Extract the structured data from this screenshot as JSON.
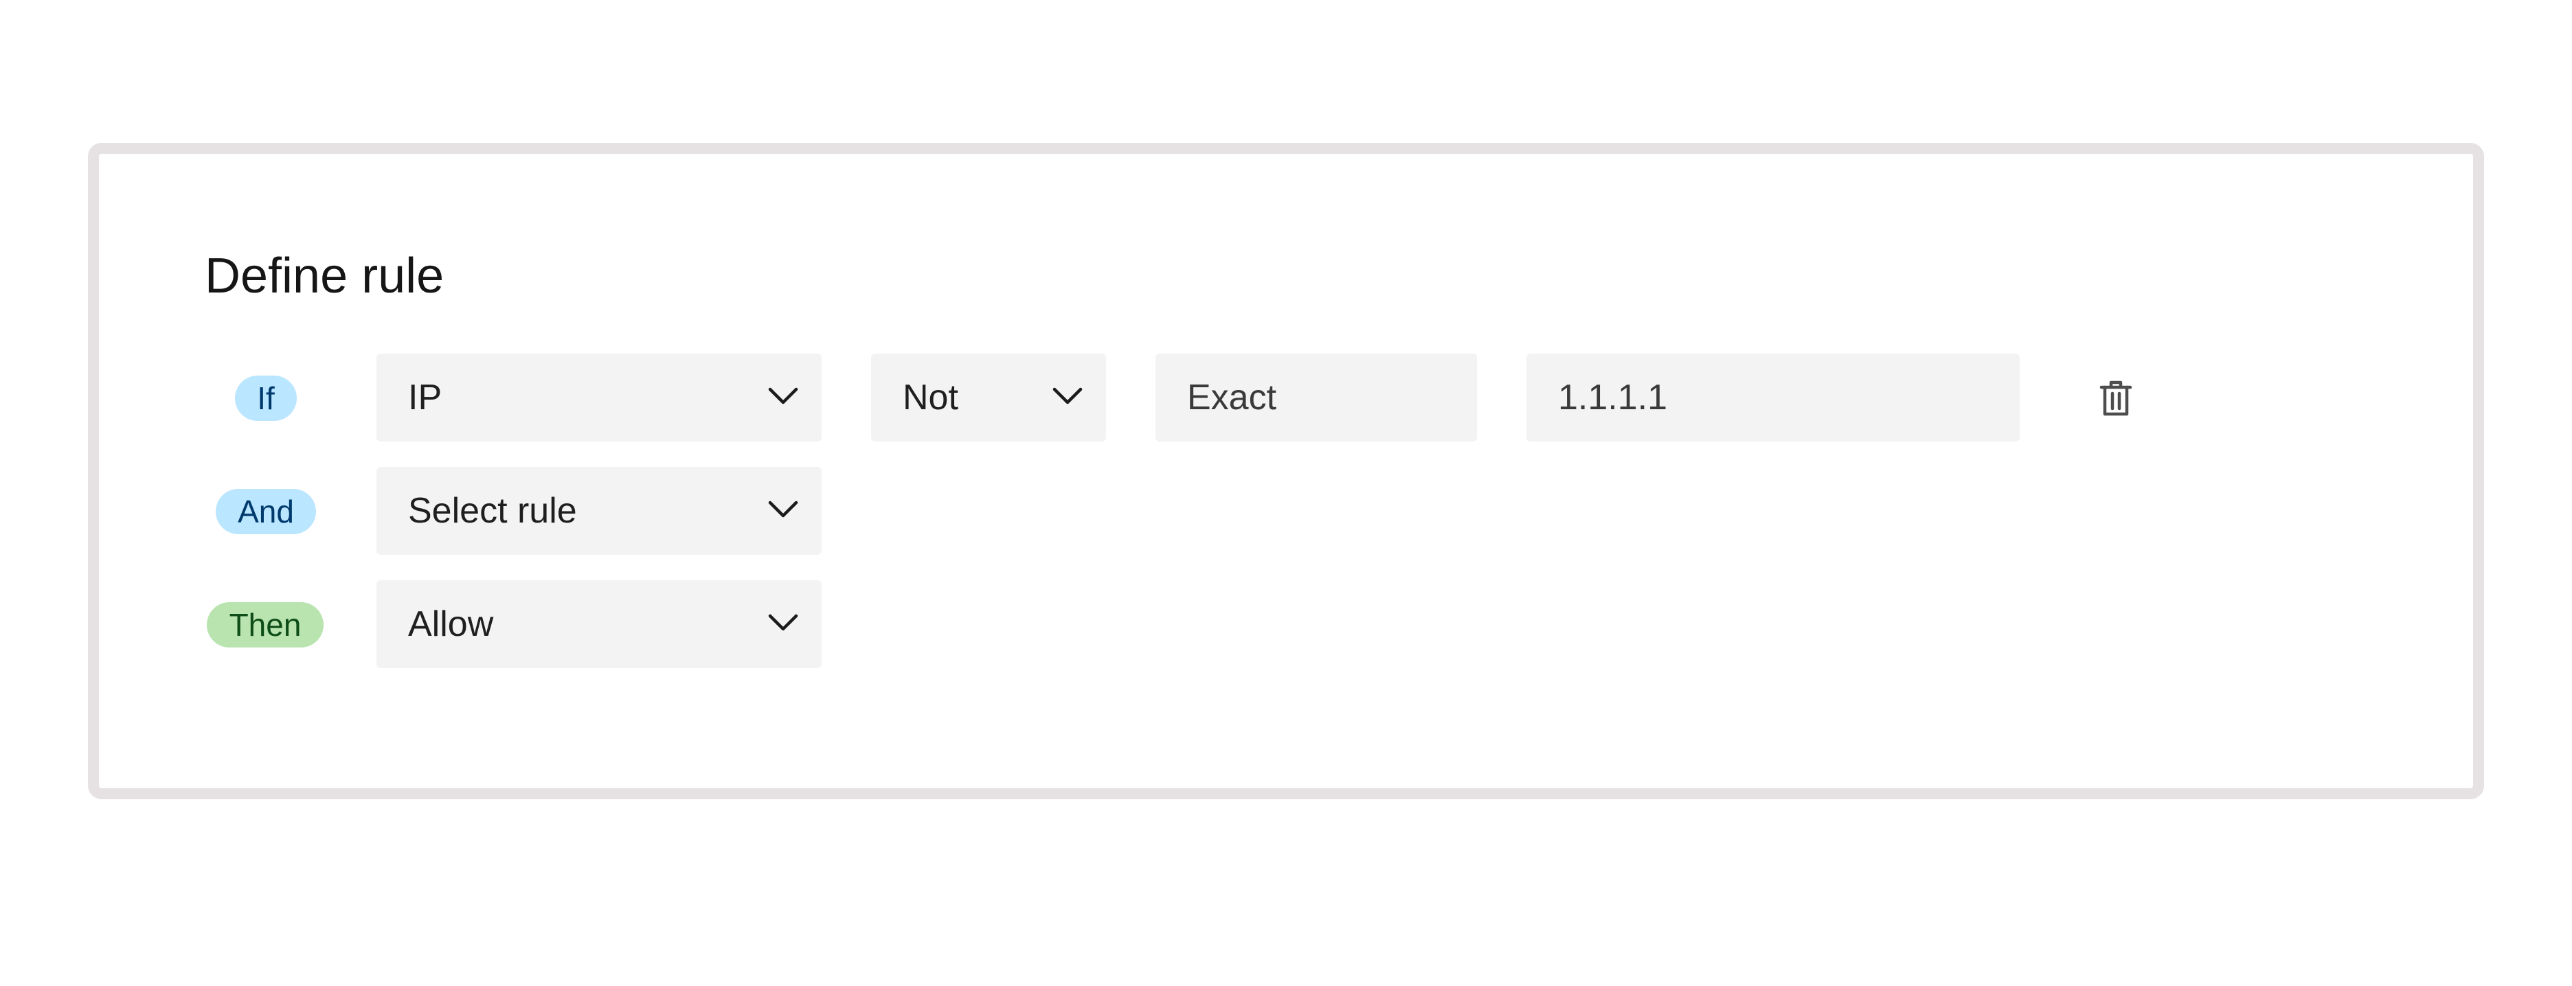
{
  "page": {
    "title": "Define rule"
  },
  "rule": {
    "if_row": {
      "tag": "If",
      "attribute": "IP",
      "operator": "Not",
      "match_type": "Exact",
      "value": "1.1.1.1",
      "delete_icon": "trash-icon"
    },
    "and_row": {
      "tag": "And",
      "select_placeholder": "Select rule"
    },
    "then_row": {
      "tag": "Then",
      "action": "Allow"
    }
  },
  "colors": {
    "tag_blue_bg": "#bae6ff",
    "tag_green_bg": "#b9e4b0",
    "field_bg": "#f3f3f3",
    "card_border": "#e6e2e3"
  }
}
